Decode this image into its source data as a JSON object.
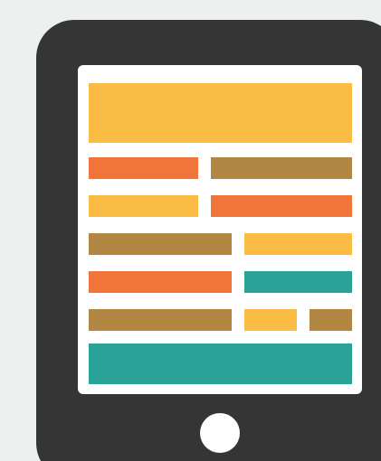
{
  "illustration": {
    "icon": "tablet-layout-icon",
    "colors": {
      "background": "#ecf0ef",
      "device_body": "#353535",
      "screen": "#ffffff",
      "home_button": "#ffffff",
      "yellow": "#fbbc45",
      "orange": "#f1753a",
      "brown": "#b18743",
      "teal": "#2aa298"
    },
    "content_rows": [
      [
        "yellow"
      ],
      [
        "orange",
        "brown"
      ],
      [
        "yellow",
        "orange"
      ],
      [
        "brown",
        "yellow"
      ],
      [
        "orange",
        "teal"
      ],
      [
        "brown",
        "yellow",
        "brown"
      ],
      [
        "teal"
      ]
    ]
  }
}
